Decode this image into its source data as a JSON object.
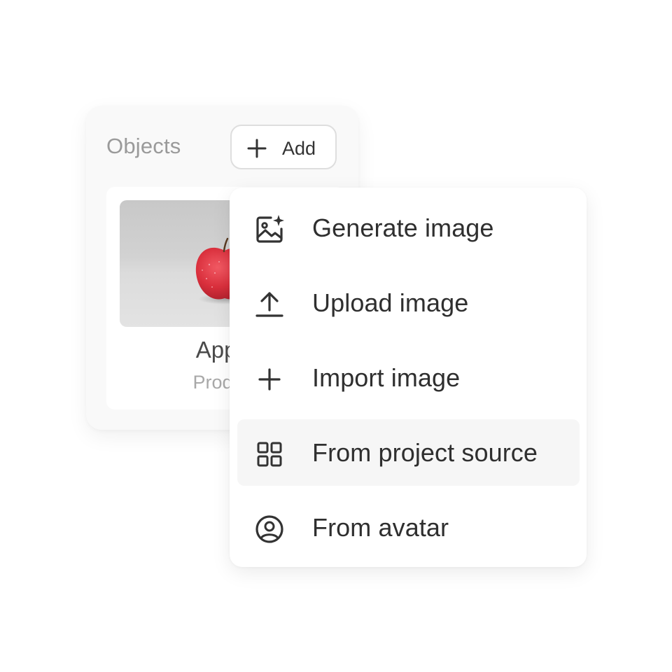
{
  "panel": {
    "title": "Objects",
    "add_button": {
      "label": "Add",
      "icon": "plus-icon"
    },
    "object_card": {
      "name": "Apple",
      "subtitle": "Product",
      "thumbnail": "apple-photo"
    }
  },
  "menu": {
    "items": [
      {
        "label": "Generate image",
        "icon": "image-sparkle-icon",
        "highlighted": false
      },
      {
        "label": "Upload image",
        "icon": "upload-icon",
        "highlighted": false
      },
      {
        "label": "Import image",
        "icon": "plus-icon",
        "highlighted": false
      },
      {
        "label": "From project source",
        "icon": "grid-icon",
        "highlighted": true
      },
      {
        "label": "From avatar",
        "icon": "user-circle-icon",
        "highlighted": false
      }
    ]
  },
  "colors": {
    "background": "#ffffff",
    "panel_background": "#f9f9f9",
    "menu_hover": "#f6f6f6",
    "text": "#2f2f2f",
    "muted_text": "#9a9a9a",
    "apple_red": "#d92f3c"
  }
}
